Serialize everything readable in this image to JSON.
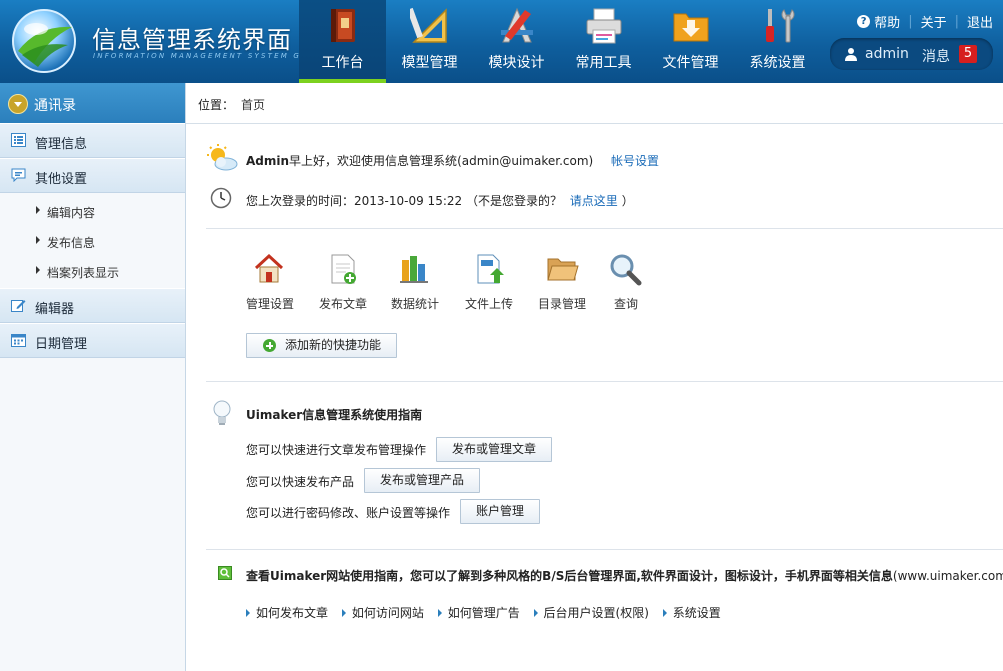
{
  "app": {
    "title": "信息管理系统界面",
    "subtitle": "INFORMATION MANAGEMENT SYSTEM GUI"
  },
  "nav": {
    "items": [
      {
        "label": "工作台",
        "icon": "book-icon",
        "active": true
      },
      {
        "label": "模型管理",
        "icon": "ruler-triangle-icon"
      },
      {
        "label": "模块设计",
        "icon": "design-tools-icon"
      },
      {
        "label": "常用工具",
        "icon": "printer-icon"
      },
      {
        "label": "文件管理",
        "icon": "folder-download-icon"
      },
      {
        "label": "系统设置",
        "icon": "wrench-screwdriver-icon"
      }
    ],
    "active_color": "#7cd11f"
  },
  "toplinks": {
    "help": "帮助",
    "about": "关于",
    "logout": "退出"
  },
  "user": {
    "name": "admin",
    "messages_label": "消息",
    "message_count": "5"
  },
  "sidebar": {
    "top": "通讯录",
    "sections": [
      {
        "label": "管理信息",
        "icon": "list-icon"
      },
      {
        "label": "其他设置",
        "icon": "chat-icon"
      },
      {
        "label": "编辑器",
        "icon": "edit-icon"
      },
      {
        "label": "日期管理",
        "icon": "calendar-icon"
      }
    ],
    "subitems": [
      "编辑内容",
      "发布信息",
      "档案列表显示"
    ]
  },
  "breadcrumb": {
    "label": "位置：",
    "current": "首页"
  },
  "welcome": {
    "name": "Admin",
    "greeting": "早上好，欢迎使用信息管理系统",
    "email": "(admin@uimaker.com)",
    "account_link": "帐号设置",
    "last_login_prefix": "您上次登录的时间：2013-10-09 15:22 （不是您登录的？",
    "last_login_link": "请点这里",
    "last_login_suffix": "）"
  },
  "shortcuts": {
    "items": [
      {
        "label": "管理设置",
        "icon": "home-icon"
      },
      {
        "label": "发布文章",
        "icon": "new-document-icon"
      },
      {
        "label": "数据统计",
        "icon": "bar-stats-icon"
      },
      {
        "label": "文件上传",
        "icon": "file-upload-icon"
      },
      {
        "label": "目录管理",
        "icon": "open-folder-icon"
      },
      {
        "label": "查询",
        "icon": "magnifier-icon"
      }
    ],
    "add_button": "添加新的快捷功能"
  },
  "guide": {
    "title": "Uimaker信息管理系统使用指南",
    "rows": [
      {
        "text": "您可以快速进行文章发布管理操作",
        "button": "发布或管理文章"
      },
      {
        "text": "您可以快速发布产品",
        "button": "发布或管理产品"
      },
      {
        "text": "您可以进行密码修改、账户设置等操作",
        "button": "账户管理"
      }
    ]
  },
  "site_guide": {
    "title": "查看Uimaker网站使用指南，您可以了解到多种风格的B/S后台管理界面,软件界面设计，图标设计，手机界面等相关信息",
    "url": "(www.uimaker.com)",
    "links": [
      "如何发布文章",
      "如何访问网站",
      "如何管理广告",
      "后台用户设置(权限)",
      "系统设置"
    ]
  }
}
